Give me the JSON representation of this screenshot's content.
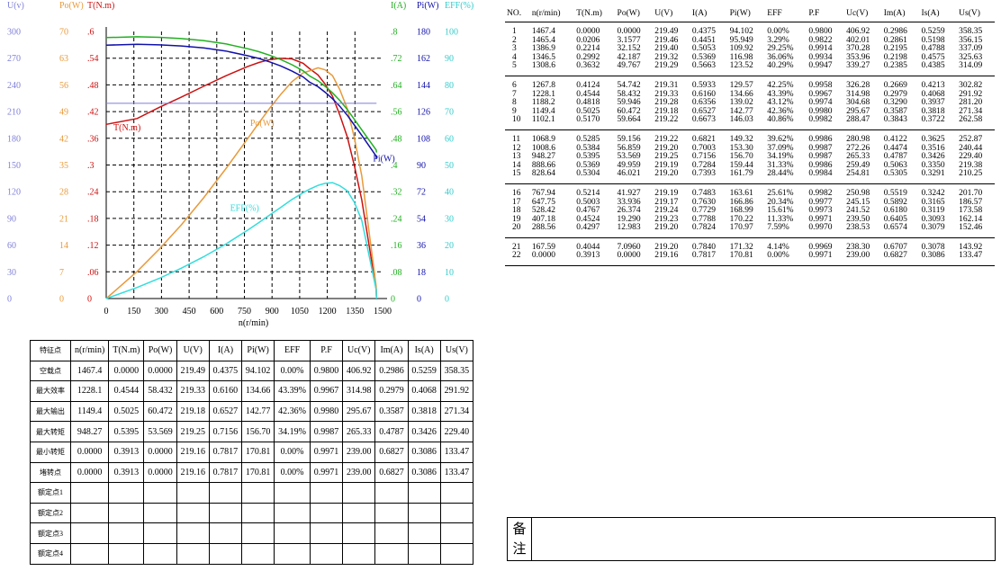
{
  "chart_data": {
    "type": "line",
    "xlabel": "n(r/min)",
    "xlim": [
      0,
      1500
    ],
    "xticks": [
      0,
      150,
      300,
      450,
      600,
      750,
      900,
      1050,
      1200,
      1350,
      1500
    ],
    "left_axes": [
      {
        "label": "U(v)",
        "color": "#7f7fd9",
        "ticks": [
          "300",
          "270",
          "240",
          "210",
          "180",
          "150",
          "120",
          "90",
          "60",
          "30",
          "0"
        ]
      },
      {
        "label": "Po(W)",
        "color": "#e89a3a",
        "ticks": [
          "70",
          "63",
          "56",
          "49",
          "42",
          "35",
          "28",
          "21",
          "14",
          "7",
          "0"
        ]
      },
      {
        "label": "T(N.m)",
        "color": "#cc1111",
        "ticks": [
          ".6",
          ".54",
          ".48",
          ".42",
          ".36",
          ".3",
          ".24",
          ".18",
          ".12",
          ".06",
          "0"
        ]
      }
    ],
    "right_axes": [
      {
        "label": "I(A)",
        "color": "#22b022",
        "ticks": [
          ".8",
          ".72",
          ".64",
          ".56",
          ".48",
          ".4",
          ".32",
          ".24",
          ".16",
          ".08",
          "0"
        ]
      },
      {
        "label": "Pi(W)",
        "color": "#1111aa",
        "ticks": [
          "180",
          "162",
          "144",
          "126",
          "108",
          "90",
          "72",
          "54",
          "36",
          "18",
          "0"
        ]
      },
      {
        "label": "EFF(%)",
        "color": "#33cccc",
        "ticks": [
          "100",
          "90",
          "80",
          "70",
          "60",
          "50",
          "40",
          "30",
          "20",
          "10",
          "0"
        ]
      }
    ],
    "series": [
      {
        "name": "T(N.m)",
        "color": "#cc1111",
        "ymax": 0.6,
        "x": [
          1467.4,
          1465.4,
          1386.9,
          1346.5,
          1308.6,
          1267.8,
          1228.1,
          1188.2,
          1149.4,
          1102.1,
          1068.9,
          1008.6,
          948.27,
          888.66,
          828.64,
          767.94,
          647.75,
          528.42,
          407.18,
          288.56,
          167.59,
          0
        ],
        "y": [
          0,
          0.0206,
          0.2214,
          0.2992,
          0.3632,
          0.4124,
          0.4544,
          0.4818,
          0.5025,
          0.517,
          0.5285,
          0.5384,
          0.5395,
          0.5369,
          0.5304,
          0.5214,
          0.5003,
          0.4767,
          0.4524,
          0.4297,
          0.4044,
          0.3913
        ]
      },
      {
        "name": "Po(W)",
        "color": "#e89a3a",
        "ymax": 70,
        "x": [
          1467.4,
          1465.4,
          1386.9,
          1346.5,
          1308.6,
          1267.8,
          1228.1,
          1188.2,
          1149.4,
          1102.1,
          1068.9,
          1008.6,
          948.27,
          888.66,
          828.64,
          767.94,
          647.75,
          528.42,
          407.18,
          288.56,
          167.59,
          0
        ],
        "y": [
          0,
          3.1577,
          32.152,
          42.187,
          49.767,
          54.742,
          58.432,
          59.946,
          60.472,
          59.664,
          59.156,
          56.859,
          53.569,
          49.959,
          46.021,
          41.927,
          33.936,
          26.374,
          19.29,
          12.983,
          7.096,
          0
        ]
      },
      {
        "name": "I(A)",
        "color": "#22b022",
        "ymax": 0.8,
        "x": [
          1467.4,
          1465.4,
          1386.9,
          1346.5,
          1308.6,
          1267.8,
          1228.1,
          1188.2,
          1149.4,
          1102.1,
          1068.9,
          1008.6,
          948.27,
          888.66,
          828.64,
          767.94,
          647.75,
          528.42,
          407.18,
          288.56,
          167.59,
          0
        ],
        "y": [
          0.4375,
          0.4451,
          0.5053,
          0.5369,
          0.5663,
          0.5933,
          0.616,
          0.6356,
          0.6527,
          0.6673,
          0.6821,
          0.7003,
          0.7156,
          0.7284,
          0.7393,
          0.7483,
          0.763,
          0.7729,
          0.7788,
          0.7824,
          0.784,
          0.7817
        ]
      },
      {
        "name": "Pi(W)",
        "color": "#1111aa",
        "ymax": 180,
        "x": [
          1467.4,
          1465.4,
          1386.9,
          1346.5,
          1308.6,
          1267.8,
          1228.1,
          1188.2,
          1149.4,
          1102.1,
          1068.9,
          1008.6,
          948.27,
          888.66,
          828.64,
          767.94,
          647.75,
          528.42,
          407.18,
          288.56,
          167.59,
          0
        ],
        "y": [
          94.102,
          95.949,
          109.92,
          116.98,
          123.52,
          129.57,
          134.66,
          139.02,
          142.77,
          146.03,
          149.32,
          153.3,
          156.7,
          159.44,
          161.79,
          163.61,
          166.86,
          168.99,
          170.22,
          170.97,
          171.32,
          170.81
        ]
      },
      {
        "name": "EFF(%)",
        "color": "#33dddd",
        "ymax": 100,
        "x": [
          1467.4,
          1465.4,
          1386.9,
          1346.5,
          1308.6,
          1267.8,
          1228.1,
          1188.2,
          1149.4,
          1102.1,
          1068.9,
          1008.6,
          948.27,
          888.66,
          828.64,
          767.94,
          647.75,
          528.42,
          407.18,
          288.56,
          167.59,
          0
        ],
        "y": [
          0,
          3.29,
          29.25,
          36.06,
          40.29,
          42.25,
          43.39,
          43.12,
          42.36,
          40.86,
          39.62,
          37.09,
          34.19,
          31.33,
          28.44,
          25.61,
          20.34,
          15.61,
          11.33,
          7.59,
          4.14,
          0
        ]
      },
      {
        "name": "U(v)",
        "color": "#7f7fd9",
        "ymax": 300,
        "x": [
          1467.4,
          0
        ],
        "y": [
          219.3,
          219.3
        ]
      }
    ]
  },
  "feature_table": {
    "headers": [
      "特征点",
      "n(r/min)",
      "T(N.m)",
      "Po(W)",
      "U(V)",
      "I(A)",
      "Pi(W)",
      "EFF",
      "P.F",
      "Uc(V)",
      "Im(A)",
      "Is(A)",
      "Us(V)"
    ],
    "rows": [
      [
        "空载点",
        "1467.4",
        "0.0000",
        "0.0000",
        "219.49",
        "0.4375",
        "94.102",
        "0.00%",
        "0.9800",
        "406.92",
        "0.2986",
        "0.5259",
        "358.35"
      ],
      [
        "最大效率",
        "1228.1",
        "0.4544",
        "58.432",
        "219.33",
        "0.6160",
        "134.66",
        "43.39%",
        "0.9967",
        "314.98",
        "0.2979",
        "0.4068",
        "291.92"
      ],
      [
        "最大输出",
        "1149.4",
        "0.5025",
        "60.472",
        "219.18",
        "0.6527",
        "142.77",
        "42.36%",
        "0.9980",
        "295.67",
        "0.3587",
        "0.3818",
        "271.34"
      ],
      [
        "最大转矩",
        "948.27",
        "0.5395",
        "53.569",
        "219.25",
        "0.7156",
        "156.70",
        "34.19%",
        "0.9987",
        "265.33",
        "0.4787",
        "0.3426",
        "229.40"
      ],
      [
        "最小转矩",
        "0.0000",
        "0.3913",
        "0.0000",
        "219.16",
        "0.7817",
        "170.81",
        "0.00%",
        "0.9971",
        "239.00",
        "0.6827",
        "0.3086",
        "133.47"
      ],
      [
        "堵转点",
        "0.0000",
        "0.3913",
        "0.0000",
        "219.16",
        "0.7817",
        "170.81",
        "0.00%",
        "0.9971",
        "239.00",
        "0.6827",
        "0.3086",
        "133.47"
      ],
      [
        "额定点1",
        "",
        "",
        "",
        "",
        "",
        "",
        "",
        "",
        "",
        "",
        "",
        ""
      ],
      [
        "额定点2",
        "",
        "",
        "",
        "",
        "",
        "",
        "",
        "",
        "",
        "",
        "",
        ""
      ],
      [
        "额定点3",
        "",
        "",
        "",
        "",
        "",
        "",
        "",
        "",
        "",
        "",
        "",
        ""
      ],
      [
        "额定点4",
        "",
        "",
        "",
        "",
        "",
        "",
        "",
        "",
        "",
        "",
        "",
        ""
      ]
    ]
  },
  "data_table": {
    "headers": [
      "NO.",
      "n(r/min)",
      "T(N.m)",
      "Po(W)",
      "U(V)",
      "I(A)",
      "Pi(W)",
      "EFF",
      "P.F",
      "Uc(V)",
      "Im(A)",
      "Is(A)",
      "Us(V)"
    ],
    "groups": [
      [
        [
          "1",
          "1467.4",
          "0.0000",
          "0.0000",
          "219.49",
          "0.4375",
          "94.102",
          "0.00%",
          "0.9800",
          "406.92",
          "0.2986",
          "0.5259",
          "358.35"
        ],
        [
          "2",
          "1465.4",
          "0.0206",
          "3.1577",
          "219.46",
          "0.4451",
          "95.949",
          "3.29%",
          "0.9822",
          "402.01",
          "0.2861",
          "0.5198",
          "356.15"
        ],
        [
          "3",
          "1386.9",
          "0.2214",
          "32.152",
          "219.40",
          "0.5053",
          "109.92",
          "29.25%",
          "0.9914",
          "370.28",
          "0.2195",
          "0.4788",
          "337.09"
        ],
        [
          "4",
          "1346.5",
          "0.2992",
          "42.187",
          "219.32",
          "0.5369",
          "116.98",
          "36.06%",
          "0.9934",
          "353.96",
          "0.2198",
          "0.4575",
          "325.63"
        ],
        [
          "5",
          "1308.6",
          "0.3632",
          "49.767",
          "219.29",
          "0.5663",
          "123.52",
          "40.29%",
          "0.9947",
          "339.27",
          "0.2385",
          "0.4385",
          "314.09"
        ]
      ],
      [
        [
          "6",
          "1267.8",
          "0.4124",
          "54.742",
          "219.31",
          "0.5933",
          "129.57",
          "42.25%",
          "0.9958",
          "326.28",
          "0.2669",
          "0.4213",
          "302.82"
        ],
        [
          "7",
          "1228.1",
          "0.4544",
          "58.432",
          "219.33",
          "0.6160",
          "134.66",
          "43.39%",
          "0.9967",
          "314.98",
          "0.2979",
          "0.4068",
          "291.92"
        ],
        [
          "8",
          "1188.2",
          "0.4818",
          "59.946",
          "219.28",
          "0.6356",
          "139.02",
          "43.12%",
          "0.9974",
          "304.68",
          "0.3290",
          "0.3937",
          "281.20"
        ],
        [
          "9",
          "1149.4",
          "0.5025",
          "60.472",
          "219.18",
          "0.6527",
          "142.77",
          "42.36%",
          "0.9980",
          "295.67",
          "0.3587",
          "0.3818",
          "271.34"
        ],
        [
          "10",
          "1102.1",
          "0.5170",
          "59.664",
          "219.22",
          "0.6673",
          "146.03",
          "40.86%",
          "0.9982",
          "288.47",
          "0.3843",
          "0.3722",
          "262.58"
        ]
      ],
      [
        [
          "11",
          "1068.9",
          "0.5285",
          "59.156",
          "219.22",
          "0.6821",
          "149.32",
          "39.62%",
          "0.9986",
          "280.98",
          "0.4122",
          "0.3625",
          "252.87"
        ],
        [
          "12",
          "1008.6",
          "0.5384",
          "56.859",
          "219.20",
          "0.7003",
          "153.30",
          "37.09%",
          "0.9987",
          "272.26",
          "0.4474",
          "0.3516",
          "240.44"
        ],
        [
          "13",
          "948.27",
          "0.5395",
          "53.569",
          "219.25",
          "0.7156",
          "156.70",
          "34.19%",
          "0.9987",
          "265.33",
          "0.4787",
          "0.3426",
          "229.40"
        ],
        [
          "14",
          "888.66",
          "0.5369",
          "49.959",
          "219.19",
          "0.7284",
          "159.44",
          "31.33%",
          "0.9986",
          "259.49",
          "0.5063",
          "0.3350",
          "219.38"
        ],
        [
          "15",
          "828.64",
          "0.5304",
          "46.021",
          "219.20",
          "0.7393",
          "161.79",
          "28.44%",
          "0.9984",
          "254.81",
          "0.5305",
          "0.3291",
          "210.25"
        ]
      ],
      [
        [
          "16",
          "767.94",
          "0.5214",
          "41.927",
          "219.19",
          "0.7483",
          "163.61",
          "25.61%",
          "0.9982",
          "250.98",
          "0.5519",
          "0.3242",
          "201.70"
        ],
        [
          "17",
          "647.75",
          "0.5003",
          "33.936",
          "219.17",
          "0.7630",
          "166.86",
          "20.34%",
          "0.9977",
          "245.15",
          "0.5892",
          "0.3165",
          "186.57"
        ],
        [
          "18",
          "528.42",
          "0.4767",
          "26.374",
          "219.24",
          "0.7729",
          "168.99",
          "15.61%",
          "0.9973",
          "241.52",
          "0.6180",
          "0.3119",
          "173.58"
        ],
        [
          "19",
          "407.18",
          "0.4524",
          "19.290",
          "219.23",
          "0.7788",
          "170.22",
          "11.33%",
          "0.9971",
          "239.50",
          "0.6405",
          "0.3093",
          "162.14"
        ],
        [
          "20",
          "288.56",
          "0.4297",
          "12.983",
          "219.20",
          "0.7824",
          "170.97",
          "7.59%",
          "0.9970",
          "238.53",
          "0.6574",
          "0.3079",
          "152.46"
        ]
      ],
      [
        [
          "21",
          "167.59",
          "0.4044",
          "7.0960",
          "219.20",
          "0.7840",
          "171.32",
          "4.14%",
          "0.9969",
          "238.30",
          "0.6707",
          "0.3078",
          "143.92"
        ],
        [
          "22",
          "0.0000",
          "0.3913",
          "0.0000",
          "219.16",
          "0.7817",
          "170.81",
          "0.00%",
          "0.9971",
          "239.00",
          "0.6827",
          "0.3086",
          "133.47"
        ]
      ]
    ]
  },
  "remarks": {
    "label_1": "备",
    "label_2": "注"
  }
}
